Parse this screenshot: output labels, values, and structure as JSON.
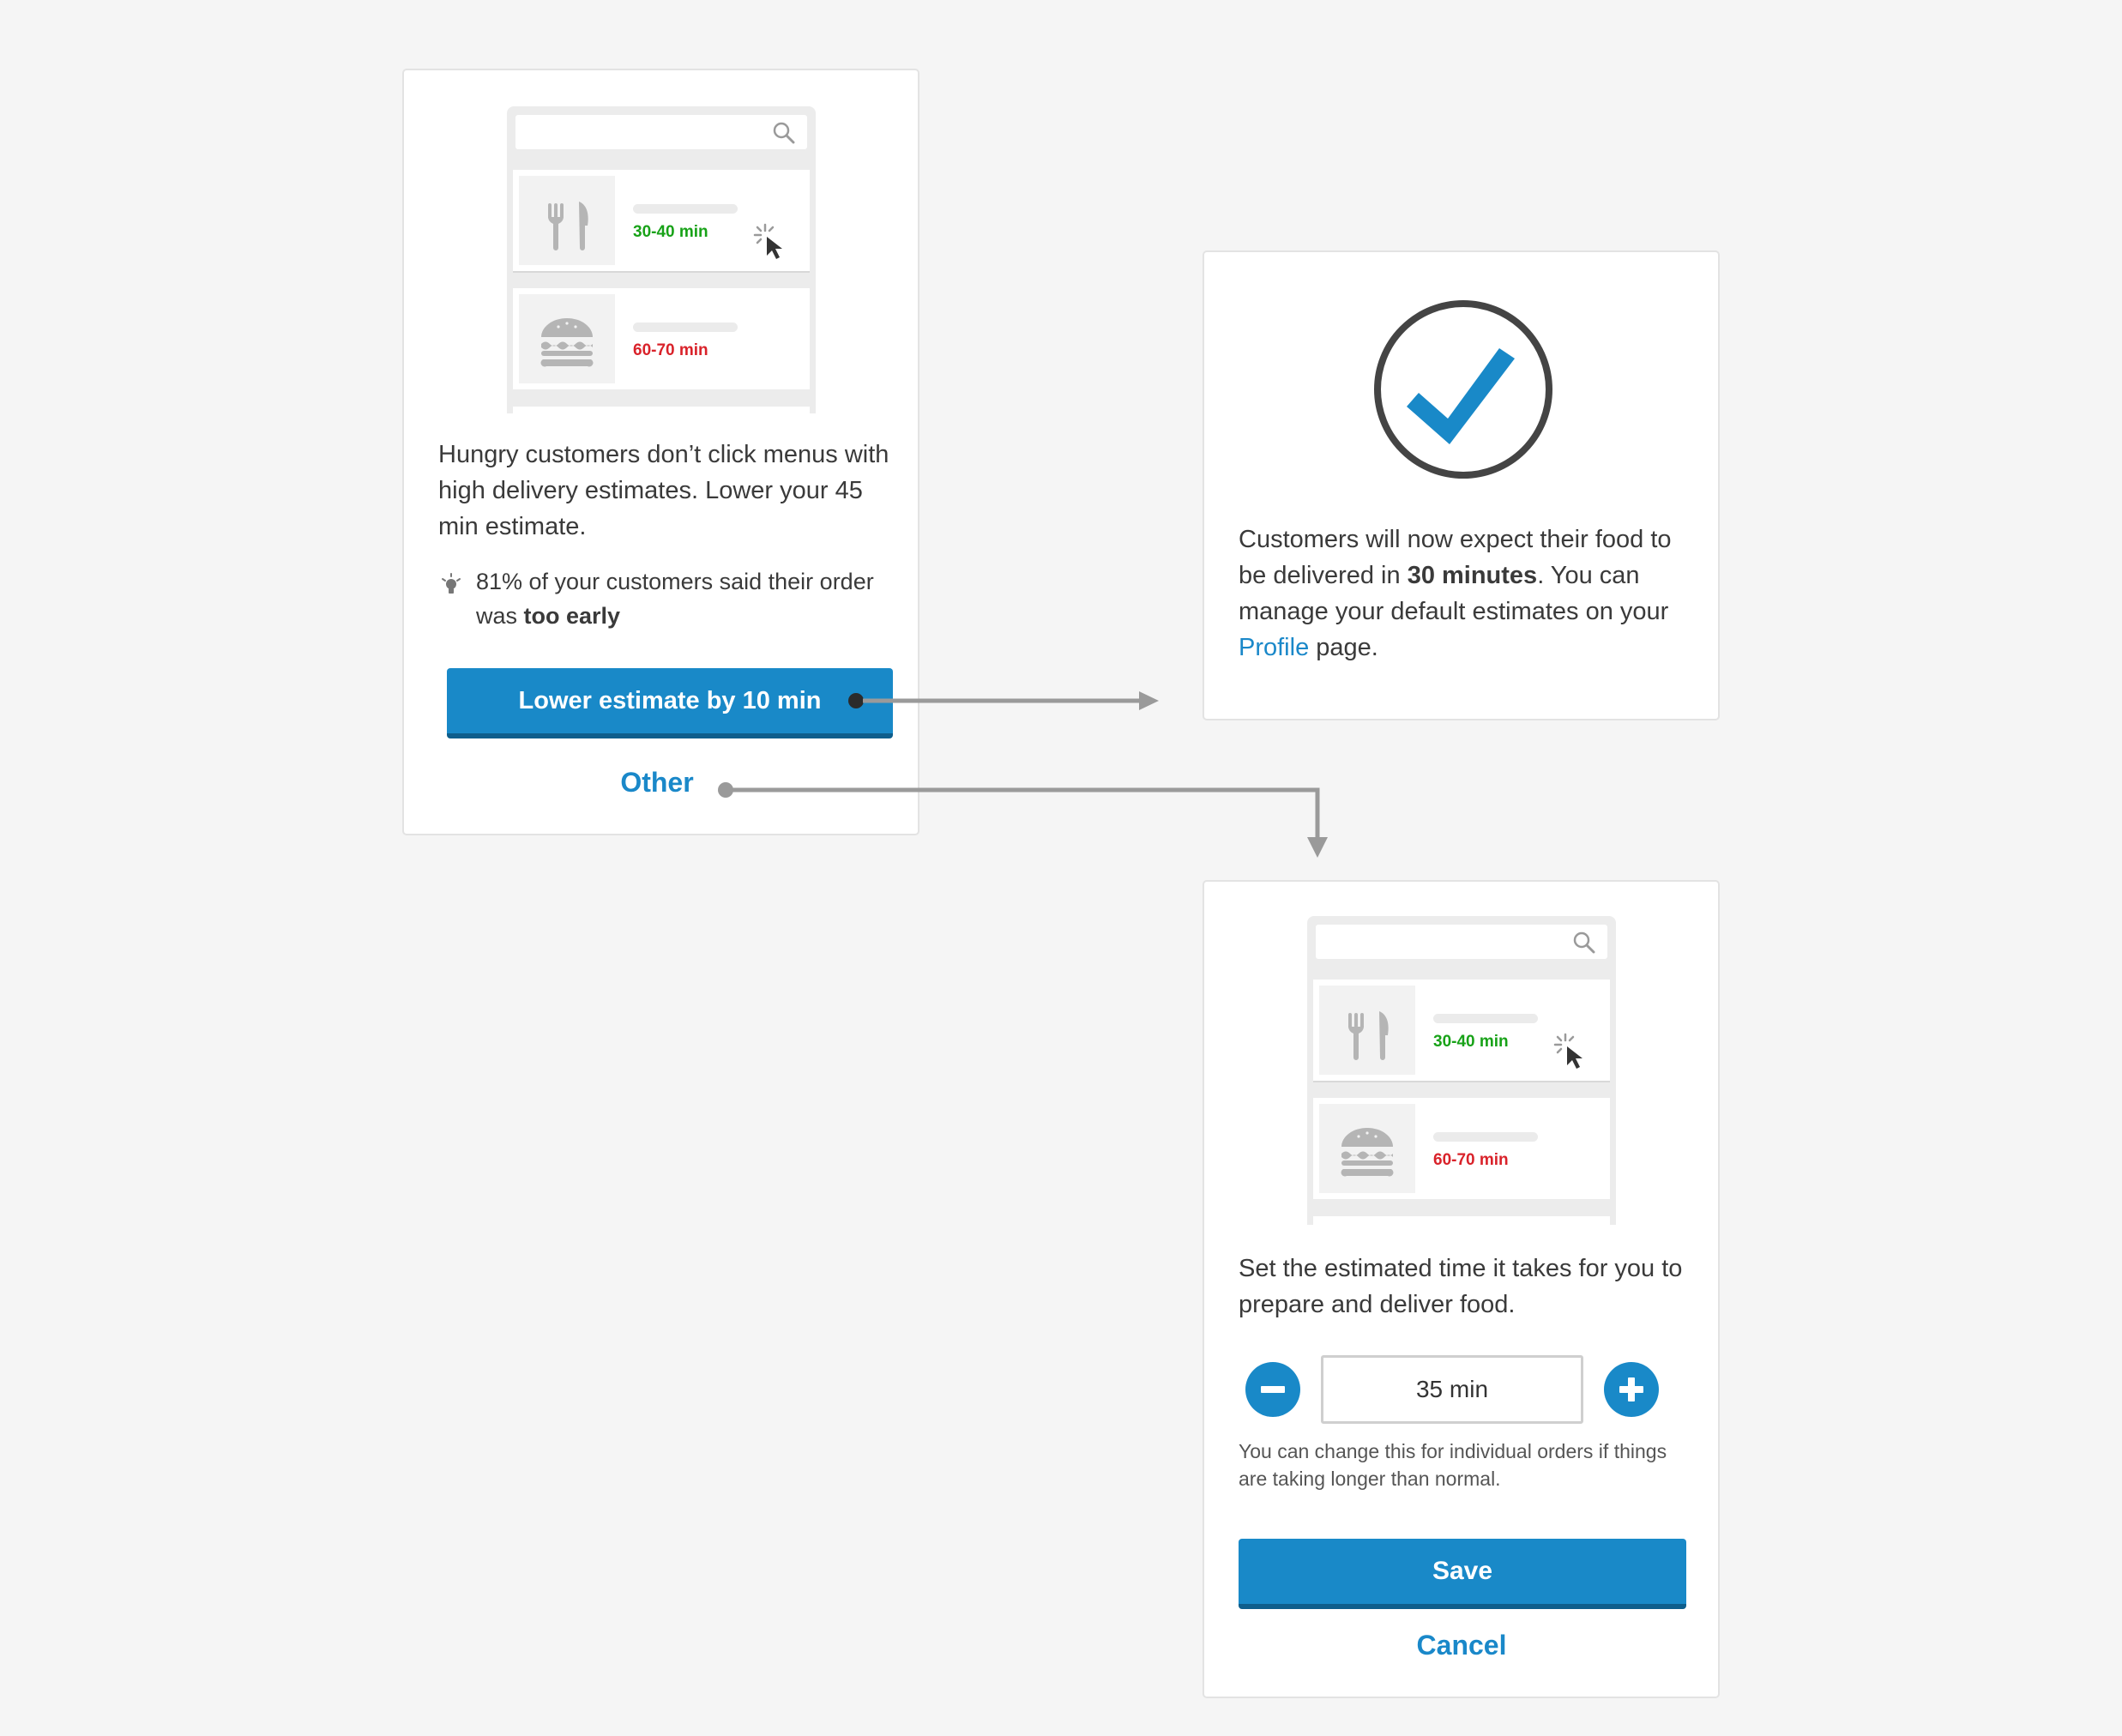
{
  "card_prompt": {
    "mock": {
      "row1_time": "30-40 min",
      "row2_time": "60-70 min"
    },
    "message": "Hungry customers don’t click menus with high delivery estimates. Lower your 45 min estimate.",
    "tip_prefix": "81% of your customers said their order was ",
    "tip_bold": "too early",
    "primary_button": "Lower estimate by 10 min",
    "secondary_link": "Other"
  },
  "card_confirm": {
    "line_prefix": "Customers will now expect their food to be delivered in ",
    "line_bold": "30 minutes",
    "line_suffix": ". You can manage your default estimates on your ",
    "link": "Profile",
    "line_end": " page."
  },
  "card_set": {
    "mock": {
      "row1_time": "30-40 min",
      "row2_time": "60-70 min"
    },
    "message": "Set the estimated time it takes for you to prepare and deliver food.",
    "stepper_value": "35 min",
    "hint": "You can change this for individual orders if things are taking longer than normal.",
    "save_button": "Save",
    "cancel_link": "Cancel"
  },
  "colors": {
    "primary": "#1989c8",
    "primary_dark": "#0e5e8c",
    "green": "#18a218",
    "red": "#d9222a",
    "connector": "#9a9a9a",
    "check": "#1989c8"
  },
  "icons": [
    "search-icon",
    "fork-knife-icon",
    "burger-icon",
    "cursor-click-icon",
    "lightbulb-icon",
    "check-circle-icon",
    "minus-icon",
    "plus-icon",
    "arrow-connector"
  ]
}
